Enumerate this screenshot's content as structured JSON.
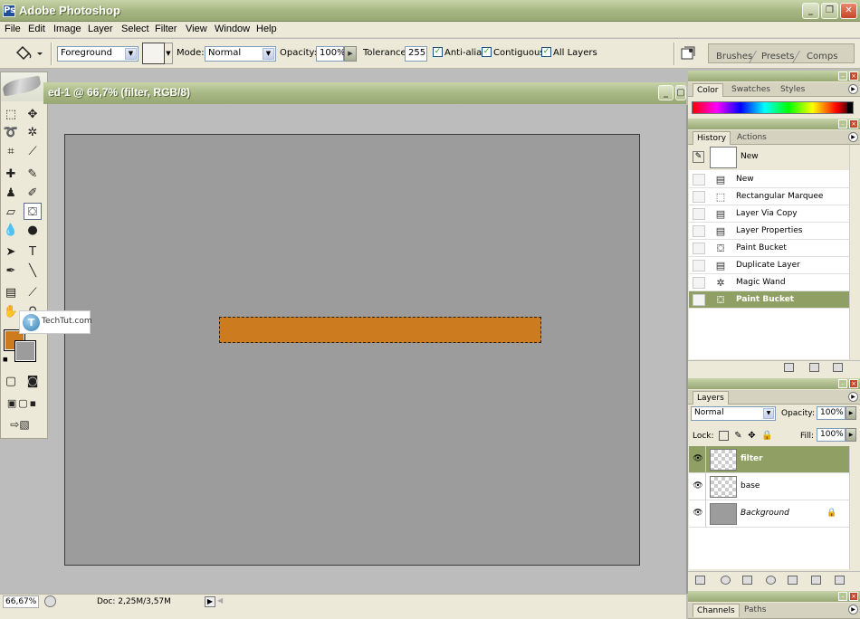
{
  "app": {
    "title": "Adobe Photoshop",
    "icon_letter": "Ps"
  },
  "window_controls": {
    "minimize": "_",
    "restore": "❐",
    "close": "✕"
  },
  "menu": [
    "File",
    "Edit",
    "Image",
    "Layer",
    "Select",
    "Filter",
    "View",
    "Window",
    "Help"
  ],
  "options": {
    "tool_icon": "paint-bucket-icon",
    "fill_source": "Foreground",
    "mode_label": "Mode:",
    "mode_value": "Normal",
    "opacity_label": "Opacity:",
    "opacity_value": "100%",
    "tolerance_label": "Tolerance:",
    "tolerance_value": "255",
    "antialias_label": "Anti-alias",
    "contiguous_label": "Contiguous",
    "all_layers_label": "All Layers",
    "check_mark": "✓"
  },
  "well_tabs": [
    "Brushes",
    "Presets",
    "Comps"
  ],
  "document": {
    "title": "ed-1 @ 66,7% (filter, RGB/8)",
    "zoom": "66,67%",
    "doc_info": "Doc: 2,25M/3,57M",
    "selection_color": "#cc7c1e",
    "canvas_color": "#9c9c9c"
  },
  "watermark": {
    "logo_letter": "T",
    "text": "TechTut.com"
  },
  "color_panel": {
    "tabs": [
      "Color",
      "Swatches",
      "Styles"
    ]
  },
  "history_panel": {
    "tabs": [
      "History",
      "Actions"
    ],
    "snapshot_label": "New",
    "items": [
      {
        "label": "New",
        "icon": "document-icon"
      },
      {
        "label": "Rectangular Marquee",
        "icon": "marquee-icon"
      },
      {
        "label": "Layer Via Copy",
        "icon": "document-icon"
      },
      {
        "label": "Layer Properties",
        "icon": "document-icon"
      },
      {
        "label": "Paint Bucket",
        "icon": "paint-bucket-icon"
      },
      {
        "label": "Duplicate Layer",
        "icon": "document-icon"
      },
      {
        "label": "Magic Wand",
        "icon": "magic-wand-icon"
      },
      {
        "label": "Paint Bucket",
        "icon": "paint-bucket-icon"
      }
    ],
    "active_index": 7
  },
  "layers_panel": {
    "tabs": [
      "Layers"
    ],
    "blend_mode": "Normal",
    "opacity_label": "Opacity:",
    "opacity_value": "100%",
    "lock_label": "Lock:",
    "fill_label": "Fill:",
    "fill_value": "100%",
    "layers": [
      {
        "name": "filter",
        "thumb": "transparent",
        "active": true
      },
      {
        "name": "base",
        "thumb": "transparent",
        "active": false
      },
      {
        "name": "Background",
        "thumb": "gray",
        "active": false,
        "locked": true
      }
    ]
  },
  "bottom_panel": {
    "tabs": [
      "Channels",
      "Paths"
    ]
  },
  "colors": {
    "foreground": "#cc7c1e",
    "background": "#9c9c9c",
    "titlebar": "#a8b884",
    "active_row": "#90a065"
  }
}
